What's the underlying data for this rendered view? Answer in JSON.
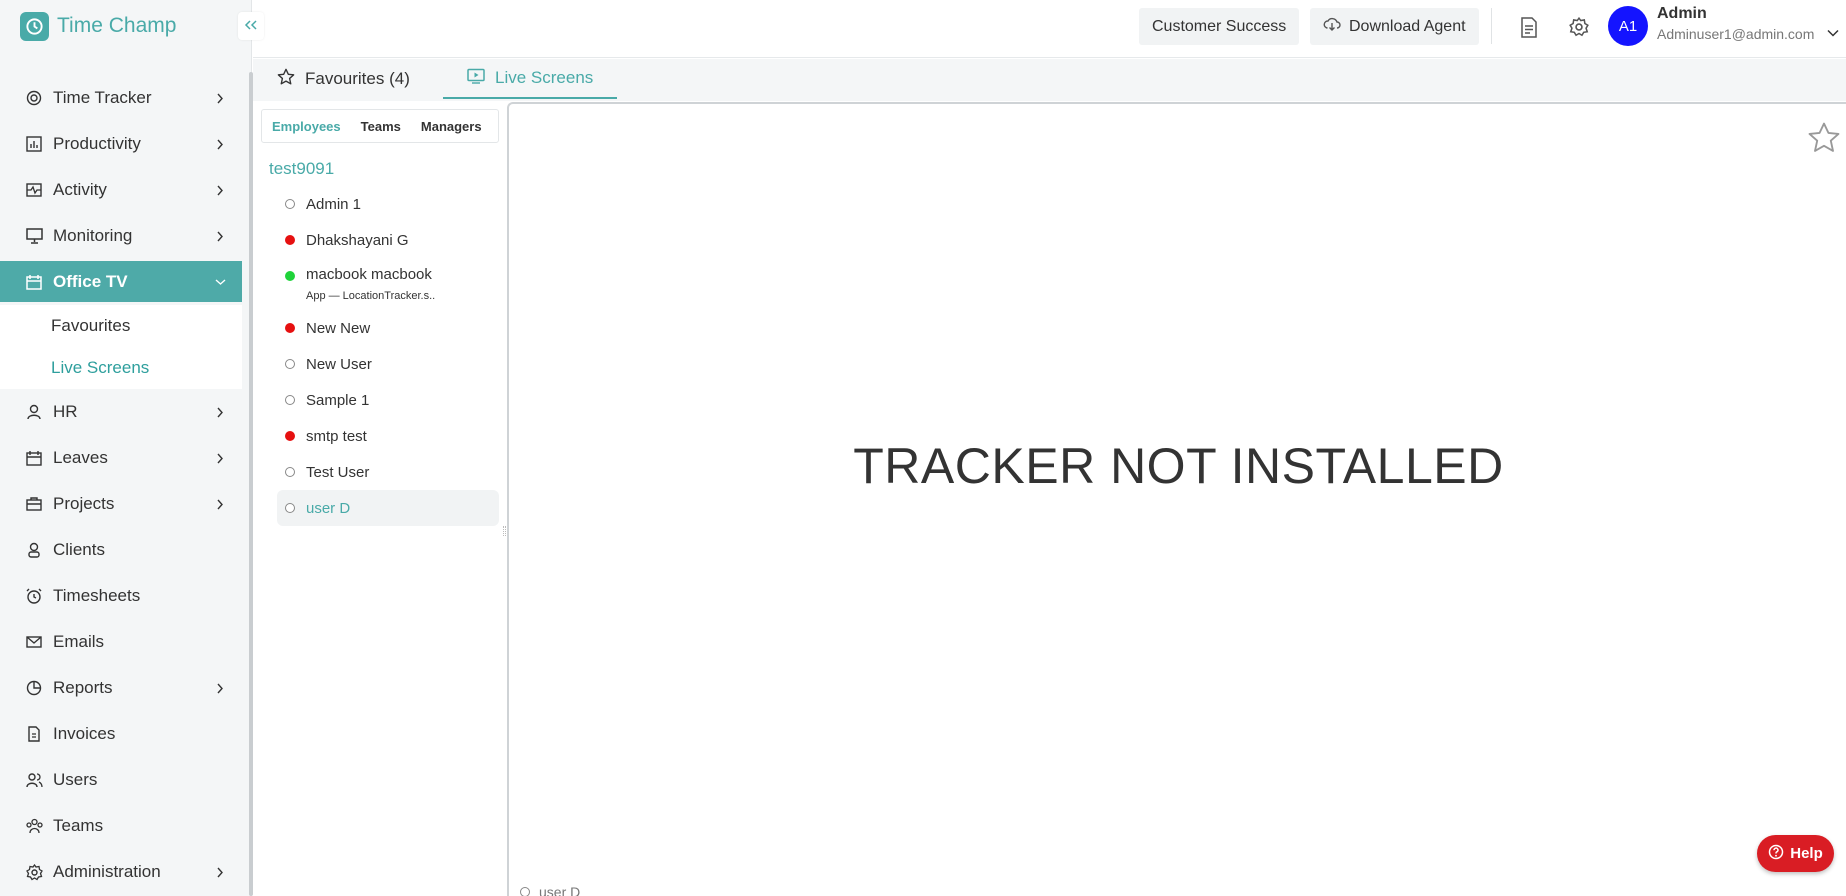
{
  "brand": {
    "name": "Time Champ"
  },
  "sidebar": {
    "items": [
      {
        "label": "Time Tracker",
        "icon": "time-tracker-icon",
        "chevron": true
      },
      {
        "label": "Productivity",
        "icon": "productivity-chart-icon",
        "chevron": true
      },
      {
        "label": "Activity",
        "icon": "activity-icon",
        "chevron": true
      },
      {
        "label": "Monitoring",
        "icon": "monitor-icon",
        "chevron": true
      },
      {
        "label": "Office TV",
        "icon": "calendar-icon",
        "chevron": true,
        "active": true
      },
      {
        "label": "HR",
        "icon": "person-icon",
        "chevron": true
      },
      {
        "label": "Leaves",
        "icon": "calendar-icon",
        "chevron": true
      },
      {
        "label": "Projects",
        "icon": "briefcase-icon",
        "chevron": true
      },
      {
        "label": "Clients",
        "icon": "client-icon",
        "chevron": false
      },
      {
        "label": "Timesheets",
        "icon": "alarm-clock-icon",
        "chevron": false
      },
      {
        "label": "Emails",
        "icon": "mail-icon",
        "chevron": false
      },
      {
        "label": "Reports",
        "icon": "pie-chart-icon",
        "chevron": true
      },
      {
        "label": "Invoices",
        "icon": "invoice-icon",
        "chevron": false
      },
      {
        "label": "Users",
        "icon": "users-icon",
        "chevron": false
      },
      {
        "label": "Teams",
        "icon": "team-icon",
        "chevron": false
      },
      {
        "label": "Administration",
        "icon": "gear-icon",
        "chevron": true
      }
    ],
    "office_tv_sub": [
      "Favourites",
      "Live Screens"
    ]
  },
  "header": {
    "customer_success": "Customer Success",
    "download_agent": "Download Agent",
    "user": {
      "initials": "A1",
      "name": "Admin",
      "email": "Adminuser1@admin.com"
    },
    "avatar_color": "#1414ff"
  },
  "tabs": {
    "favourites": "Favourites (4)",
    "live_screens": "Live Screens"
  },
  "employee_panel": {
    "subtabs": [
      "Employees",
      "Teams",
      "Managers"
    ],
    "group": "test9091",
    "employees": [
      {
        "name": "Admin 1",
        "status": "offline"
      },
      {
        "name": "Dhakshayani G",
        "status": "red"
      },
      {
        "name": "macbook macbook",
        "status": "green",
        "sub": "App — LocationTracker.s.."
      },
      {
        "name": "New New",
        "status": "red"
      },
      {
        "name": "New User",
        "status": "offline"
      },
      {
        "name": "Sample 1",
        "status": "offline"
      },
      {
        "name": "smtp test",
        "status": "red"
      },
      {
        "name": "Test User",
        "status": "offline"
      },
      {
        "name": "user D",
        "status": "offline",
        "selected": true
      }
    ]
  },
  "screen": {
    "message": "TRACKER NOT INSTALLED",
    "user_label": "user D"
  },
  "help": {
    "label": "Help"
  },
  "colors": {
    "accent": "#49aaa8",
    "offline": "#888888",
    "busy": "#e61010",
    "online": "#1fd33a",
    "help": "#d91d24"
  }
}
